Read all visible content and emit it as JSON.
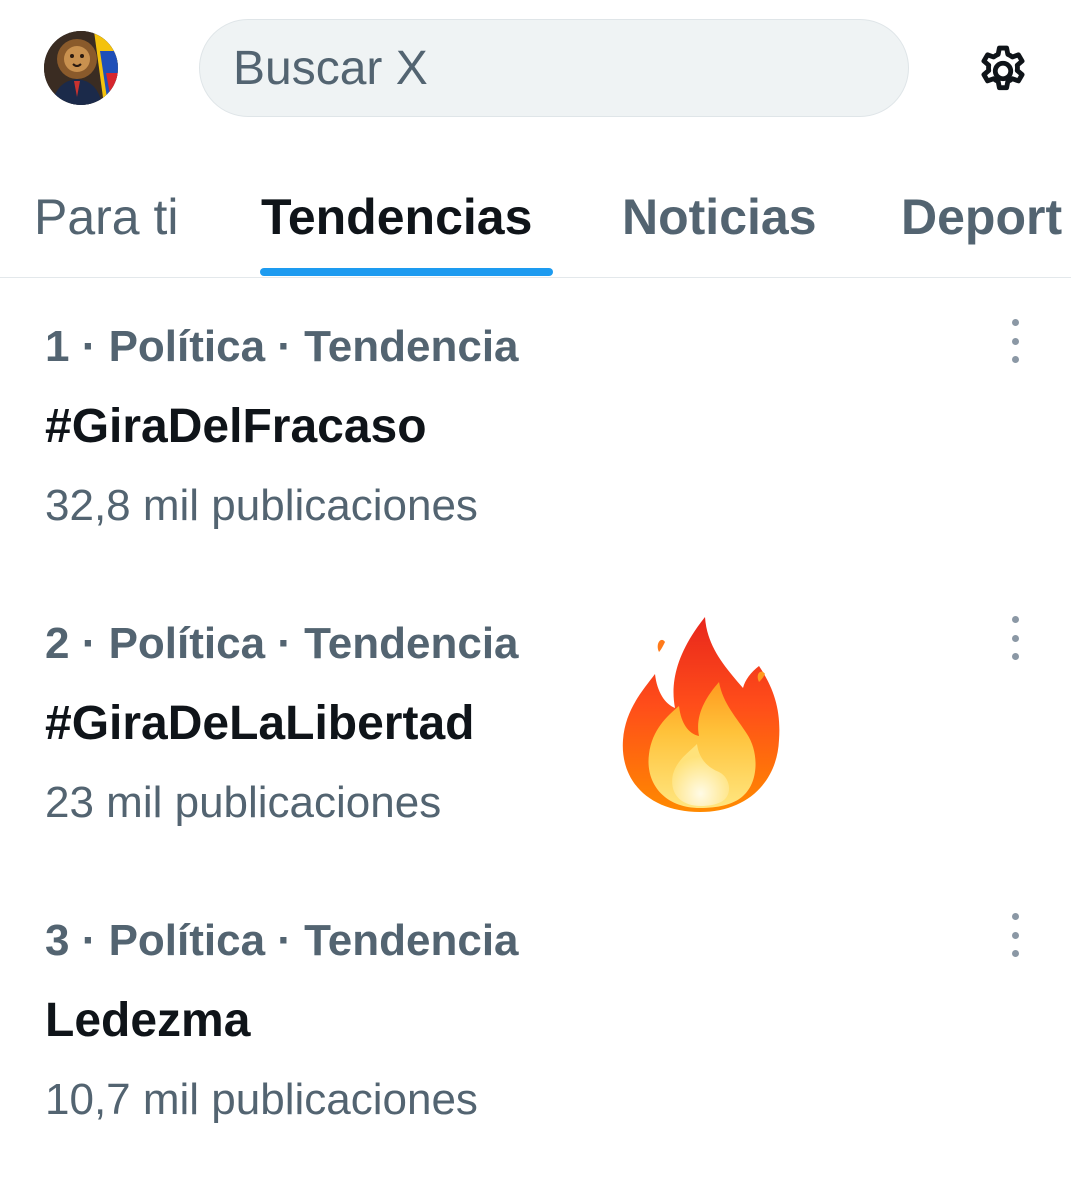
{
  "header": {
    "avatar_icon": "profile-avatar-lion",
    "search_placeholder": "Buscar X",
    "settings_icon": "gear-icon"
  },
  "tabs": [
    {
      "label": "Para ti",
      "active": false
    },
    {
      "label": "Tendencias",
      "active": true
    },
    {
      "label": "Noticias",
      "active": false
    },
    {
      "label": "Deport",
      "active": false
    }
  ],
  "trends": [
    {
      "meta": "1 · Política · Tendencia",
      "title": "#GiraDelFracaso",
      "count": "32,8 mil publicaciones"
    },
    {
      "meta": "2 · Política · Tendencia",
      "title": "#GiraDeLaLibertad",
      "count": "23 mil publicaciones"
    },
    {
      "meta": "3 · Política · Tendencia",
      "title": "Ledezma",
      "count": "10,7 mil publicaciones"
    }
  ],
  "overlay": {
    "emoji": "fire-emoji"
  },
  "colors": {
    "accent": "#1d9bf0",
    "text_primary": "#0f1419",
    "text_secondary": "#536471",
    "search_bg": "#eff3f4"
  }
}
